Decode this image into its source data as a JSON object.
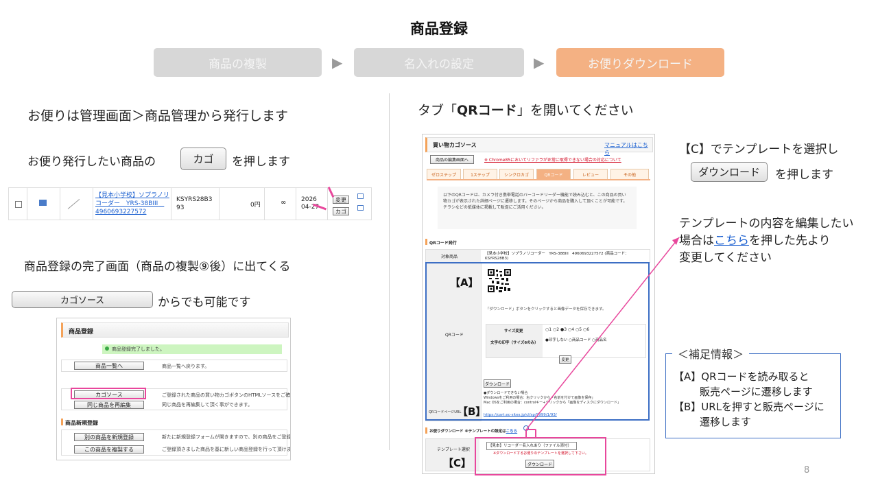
{
  "page_title": "商品登録",
  "steps": [
    "商品の複製",
    "名入れの設定",
    "お便りダウンロード"
  ],
  "left": {
    "heading": "お便りは管理画面＞商品管理から発行します",
    "line1_before": "お便り発行したい商品の",
    "line1_button": "カゴ",
    "line1_after": "を押します",
    "row": {
      "name": "【見本小学校】ソプラノリコーダー　YRS-38BIII　4960693227572",
      "code": "KSYRS28B3 93",
      "price": "0円",
      "stock": "∞",
      "date": "2026 04-27",
      "btn_edit": "変更",
      "btn_cart": "カゴ"
    },
    "complete_text": "商品登録の完了画面（商品の複製⑨後）に出てくる",
    "source_button": "カゴソース",
    "source_after": "からでも可能です",
    "screen": {
      "header": "商品登録",
      "done": "商品登録完了しました。",
      "rows": [
        {
          "btn": "商品一覧へ",
          "desc": "商品一覧へ戻ります。"
        },
        {
          "btn": "カゴソース",
          "desc": "ご登録された商品の買い物カゴボタンのHTMLソースをご確認頂けます。"
        },
        {
          "btn": "同じ商品を再編集",
          "desc": "同じ商品を再編集して頂く事ができます。"
        }
      ],
      "section2": "商品新規登録",
      "rows2": [
        {
          "btn": "別の商品を新規登録",
          "desc": "新たに新規登録フォームが開きますので、別の商品をご登録頂けます。"
        },
        {
          "btn": "この商品を複製する",
          "desc": "ご登録頂きました商品を基に新しい商品登録を行って頂けます。"
        }
      ]
    }
  },
  "right": {
    "heading_before": "タブ「",
    "heading_bold": "QRコード",
    "heading_after": "」を開いてください",
    "instr_c": "【C】でテンプレートを選択し",
    "download_button": "ダウンロード",
    "download_after": "を押します",
    "edit_line1": "テンプレートの内容を編集したい",
    "edit_line2_before": "場合は",
    "edit_line2_link": "こちら",
    "edit_line2_after": "を押した先より",
    "edit_line3": "変更してください",
    "supp_title": "＜補足情報＞",
    "supp_a1": "【A】QRコードを読み取ると",
    "supp_a2": "販売ページに遷移します",
    "supp_b1": "【B】URLを押すと販売ページに",
    "supp_b2": "遷移します",
    "label_a": "【A】",
    "label_b": "【B】",
    "label_c": "【C】",
    "screen": {
      "header": "買い物カゴソース",
      "manual": "マニュアルはこちら",
      "edit_btn": "商品の編集画面へ",
      "notice": "※ Chrome85においてリファラが正常に取得できない場合の対応について",
      "tabs": [
        "ゼロステップ",
        "1ステップ",
        "シンクロカゴ",
        "QRコード",
        "レビュー",
        "その他"
      ],
      "desc": "以下のQRコードは、カメラ付き携帯電話のバーコードリーダー機能で読み込むと、この商品の買い物カゴが表示された詳細ページに遷移します。そのページから商品を購入して頂くことが可能です。チラシなどの紙媒体に掲載して販促にご活用ください。",
      "section": "QRコード発行",
      "target_label": "対象商品",
      "target_value": "【見本小学校】ソプラノリコーダー　YRS-38BIII　4960693227572 (商品コード：KSYRS28B3)",
      "qr_label": "QRコード",
      "qr_note": "「ダウンロード」ボタンをクリックすると画像データを保存できます。",
      "size_label": "サイズ変更",
      "sizes": [
        "1",
        "2",
        "3",
        "4",
        "5",
        "6"
      ],
      "text_label": "文字の印字（サイズ6のみ）",
      "text_opts": [
        "印字しない",
        "商品コード",
        "商品名"
      ],
      "change_btn": "変更",
      "download_btn": "ダウンロード",
      "dl_note1": "●ダウンロードできない場合",
      "dl_note2": "Windowsをご利用の場合：右クリックから「名前を付けて画像を保存」",
      "dl_note3": "Mac OSをご利用の場合：controlキー+クリックから「画像をディスクにダウンロード」",
      "url_label": "QRコードページURL",
      "url": "https://cart.ec-sites.jp/cl/sp/9999/1/93/",
      "otayori_label": "お便りダウンロード",
      "otayori_note": "※テンプレートの設定は",
      "otayori_link": "こちら",
      "template_label": "テンプレート選択",
      "template_value": "【見本】リコーダー名入れあり（ファイル添付）",
      "template_note": "※ダウンロードするお便りのテンプレートを選択して下さい。",
      "final_btn": "ダウンロード"
    }
  },
  "page_number": "8"
}
